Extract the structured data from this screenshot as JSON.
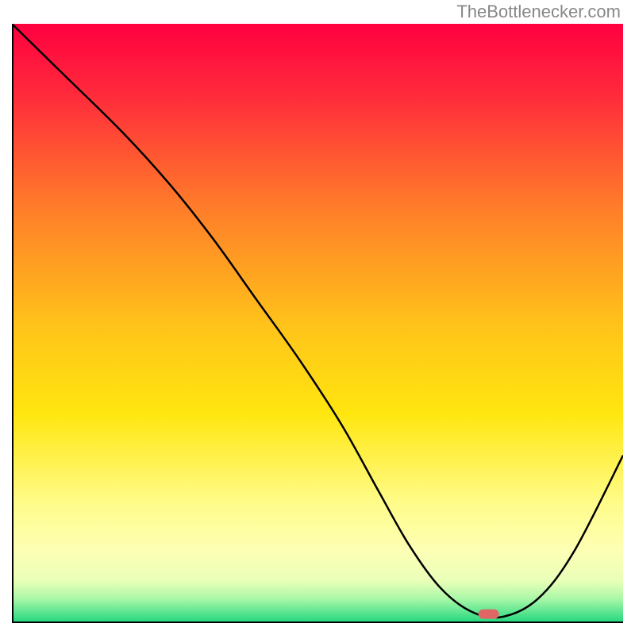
{
  "watermark": "TheBottlenecker.com",
  "chart_data": {
    "type": "line",
    "title": "",
    "xlabel": "",
    "ylabel": "",
    "xlim": [
      0,
      100
    ],
    "ylim": [
      0,
      100
    ],
    "gradient_stops": [
      {
        "offset": 0,
        "color": "#ff0040"
      },
      {
        "offset": 12,
        "color": "#ff2b3b"
      },
      {
        "offset": 30,
        "color": "#ff7a2a"
      },
      {
        "offset": 50,
        "color": "#ffc21a"
      },
      {
        "offset": 65,
        "color": "#ffe60f"
      },
      {
        "offset": 80,
        "color": "#fffc8a"
      },
      {
        "offset": 88,
        "color": "#fdffb5"
      },
      {
        "offset": 93,
        "color": "#e9ffb8"
      },
      {
        "offset": 96,
        "color": "#a7f7a7"
      },
      {
        "offset": 100,
        "color": "#1fd67e"
      }
    ],
    "curve": {
      "x": [
        0,
        8,
        18,
        26,
        33,
        40,
        47,
        54,
        60,
        65,
        70,
        75,
        80,
        86,
        92,
        100
      ],
      "y": [
        100,
        92,
        82,
        73,
        64,
        54,
        44,
        33,
        22,
        13,
        6,
        2,
        1,
        4,
        12,
        28
      ]
    },
    "marker": {
      "x": 78,
      "y": 1.5,
      "color": "#e06666"
    }
  }
}
